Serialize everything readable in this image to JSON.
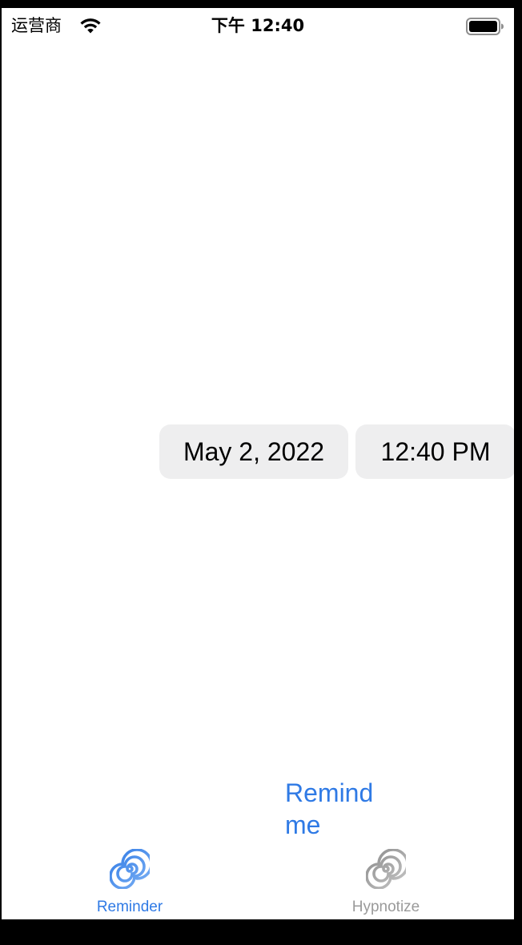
{
  "status_bar": {
    "carrier": "运营商",
    "time": "下午 12:40",
    "wifi_icon": "wifi-icon",
    "battery_icon": "battery-icon"
  },
  "pickers": {
    "date": "May 2, 2022",
    "time": "12:40 PM"
  },
  "remind_button": {
    "label": "Remind\nme",
    "color": "#2f7ae5"
  },
  "tab_bar": {
    "selected": "Reminder",
    "items": [
      {
        "label": "Reminder",
        "icon": "spiral-icon",
        "color": "#2f7ae5"
      },
      {
        "label": "Hypnotize",
        "icon": "spiral-icon",
        "color": "#9a9a9a"
      }
    ]
  },
  "colors": {
    "accent": "#2f7ae5",
    "picker_bg": "#eeeeef",
    "inactive": "#9a9a9a"
  }
}
